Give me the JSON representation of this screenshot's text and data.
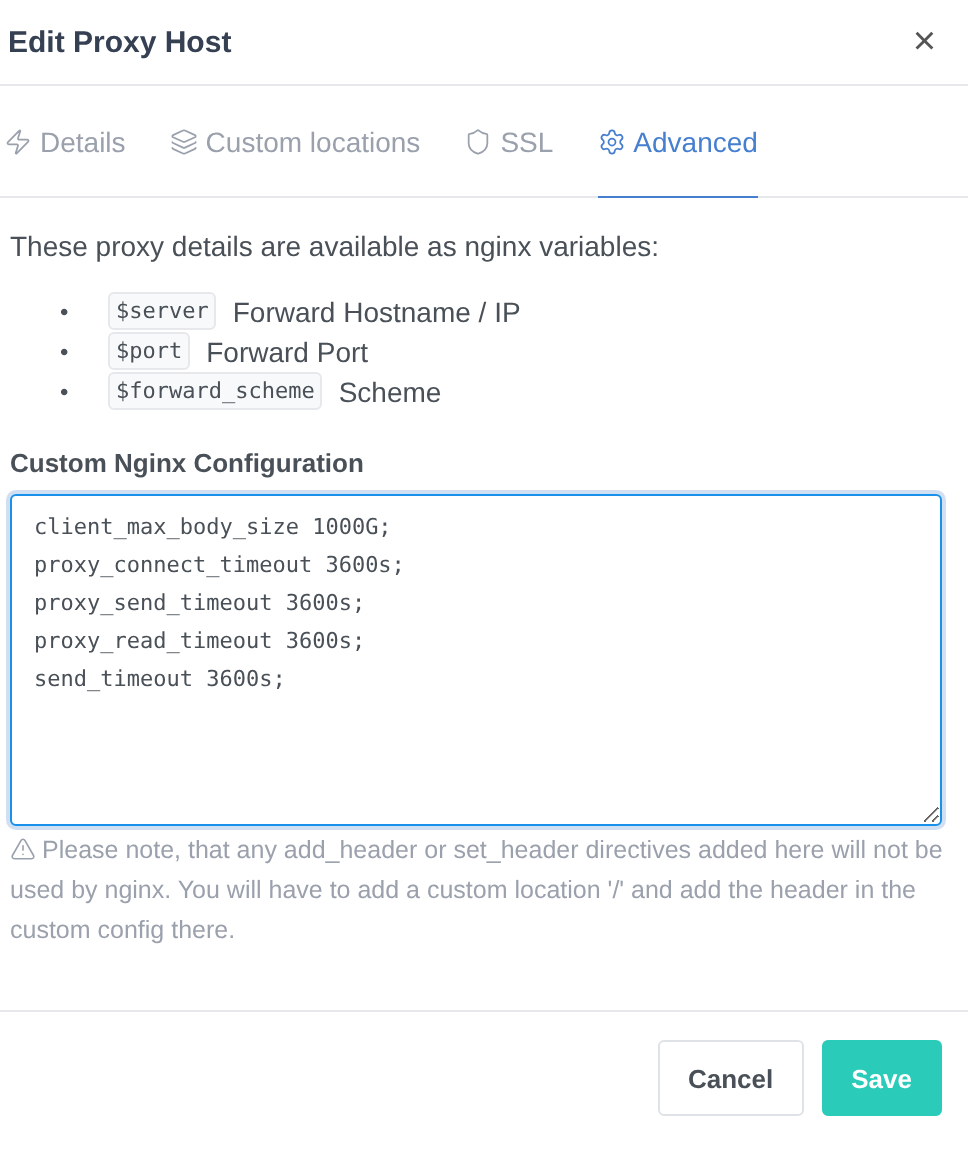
{
  "dialog": {
    "title": "Edit Proxy Host",
    "close": "×"
  },
  "tabs": [
    {
      "label": "Details",
      "selected": false
    },
    {
      "label": "Custom locations",
      "selected": false
    },
    {
      "label": "SSL",
      "selected": false
    },
    {
      "label": "Advanced",
      "selected": true
    }
  ],
  "intro": "These proxy details are available as nginx variables:",
  "variables": [
    {
      "bullet": "•",
      "code": "$server",
      "text": "Forward Hostname / IP"
    },
    {
      "bullet": "•",
      "code": "$port",
      "text": "Forward Port"
    },
    {
      "bullet": "•",
      "code": "$forward_scheme",
      "text": "Scheme"
    }
  ],
  "config": {
    "label": "Custom Nginx Configuration",
    "lines": [
      "client_max_body_size 1000G;",
      "proxy_connect_timeout 3600s;",
      "proxy_send_timeout 3600s;",
      "proxy_read_timeout 3600s;",
      "send_timeout 3600s;"
    ],
    "focused": true
  },
  "note": "Please note, that any add_header or set_header directives added here will not be used by nginx. You will have to add a custom location '/' and add the header in the custom config there.",
  "buttons": [
    {
      "label": "Cancel",
      "kind": "secondary"
    },
    {
      "label": "Save",
      "kind": "primary"
    }
  ]
}
